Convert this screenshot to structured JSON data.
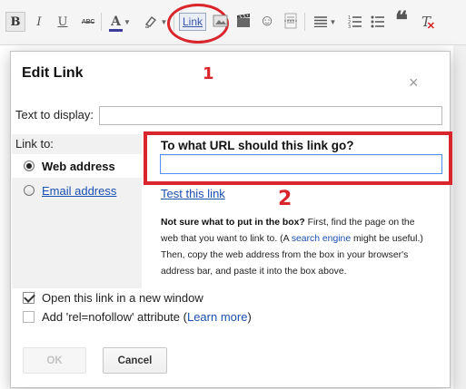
{
  "toolbar": {
    "bold": "B",
    "italic": "I",
    "underline": "U",
    "strike": "ABC",
    "text_color": "A",
    "link": "Link",
    "quote": "❝",
    "clear": "T"
  },
  "annotations": {
    "marker_1": "1",
    "marker_2": "2",
    "color": "#d9262c"
  },
  "dialog": {
    "title": "Edit Link",
    "close": "×",
    "text_to_display_label": "Text to display:",
    "text_to_display_value": "",
    "link_to_label": "Link to:",
    "options": [
      {
        "label": "Web address",
        "selected": true
      },
      {
        "label": "Email address",
        "selected": false
      }
    ],
    "url_question": "To what URL should this link go?",
    "url_value": "",
    "test_link": "Test this link",
    "help": {
      "bold": "Not sure what to put in the box?",
      "line1_rest": " First, find the page on the",
      "line2_a": "web that you want to link to. (A ",
      "line2_link": "search engine",
      "line2_b": " might be useful.)",
      "line3": "Then, copy the web address from the box in your browser's",
      "line4": "address bar, and paste it into the box above."
    },
    "open_new_window": {
      "label": "Open this link in a new window",
      "checked": true
    },
    "nofollow": {
      "label_a": "Add 'rel=nofollow' attribute (",
      "link": "Learn more",
      "label_b": ")",
      "checked": false
    },
    "ok": "OK",
    "cancel": "Cancel"
  },
  "colors": {
    "link": "#1a4fb4",
    "focus_border": "#4d90fe"
  }
}
